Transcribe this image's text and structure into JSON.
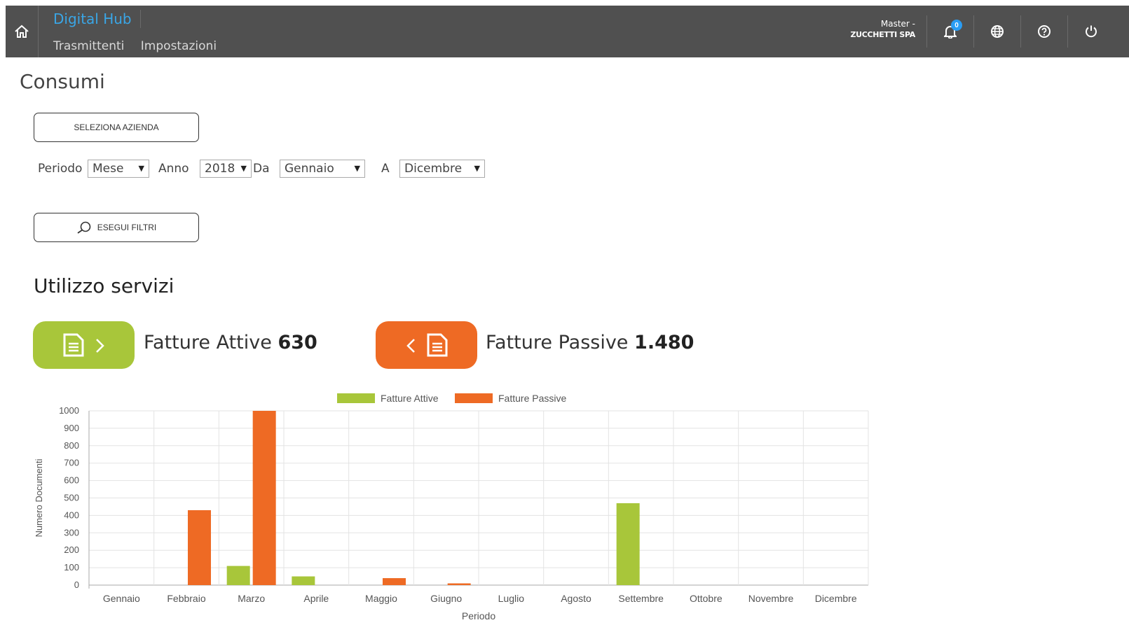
{
  "header": {
    "brand": "Digital Hub",
    "nav": [
      "Trasmittenti",
      "Impostazioni"
    ],
    "user_line1": "Master -",
    "user_line2": "ZUCCHETTI SPA",
    "notifications_count": "0"
  },
  "page": {
    "title": "Consumi"
  },
  "buttons": {
    "select_company": "SELEZIONA AZIENDA",
    "run_filters": "ESEGUI FILTRI"
  },
  "filters": {
    "period_label": "Periodo",
    "period_value": "Mese",
    "year_label": "Anno",
    "year_value": "2018",
    "from_label": "Da",
    "from_value": "Gennaio",
    "to_label": "A",
    "to_value": "Dicembre"
  },
  "section": {
    "title": "Utilizzo servizi"
  },
  "stats": {
    "active_label": "Fatture Attive",
    "active_value": "630",
    "passive_label": "Fatture Passive",
    "passive_value": "1.480"
  },
  "colors": {
    "active": "#a8c63a",
    "passive": "#ee6a24",
    "topbar": "#505050",
    "brand": "#3aa6e6"
  },
  "chart_data": {
    "type": "bar",
    "categories": [
      "Gennaio",
      "Febbraio",
      "Marzo",
      "Aprile",
      "Maggio",
      "Giugno",
      "Luglio",
      "Agosto",
      "Settembre",
      "Ottobre",
      "Novembre",
      "Dicembre"
    ],
    "series": [
      {
        "name": "Fatture Attive",
        "values": [
          0,
          0,
          110,
          50,
          0,
          0,
          0,
          0,
          470,
          0,
          0,
          0
        ]
      },
      {
        "name": "Fatture Passive",
        "values": [
          0,
          430,
          1000,
          0,
          40,
          10,
          0,
          0,
          0,
          0,
          0,
          0
        ]
      }
    ],
    "xlabel": "Periodo",
    "ylabel": "Numero Documenti",
    "ylim": [
      0,
      1000
    ],
    "yticks": [
      0,
      100,
      200,
      300,
      400,
      500,
      600,
      700,
      800,
      900,
      1000
    ],
    "legend": "top-center",
    "grid": true
  }
}
